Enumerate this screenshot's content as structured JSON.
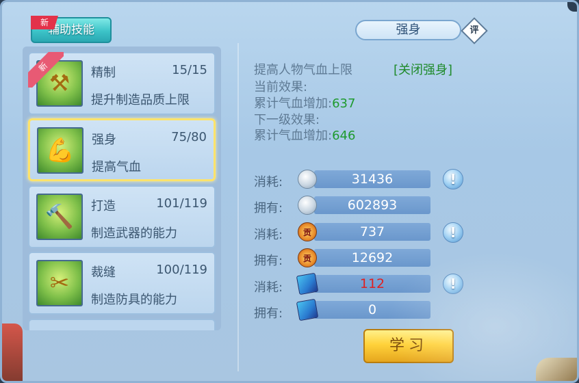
{
  "header": {
    "tab_label": "辅助技能",
    "tab_new_badge": "新",
    "title": "强身",
    "rate_label": "评"
  },
  "skills": [
    {
      "name": "精制",
      "level": "15/15",
      "desc": "提升制造品质上限",
      "new_badge": "新",
      "icon": "crafting-tools-icon"
    },
    {
      "name": "强身",
      "level": "75/80",
      "desc": "提高气血",
      "selected": true,
      "icon": "strong-man-icon"
    },
    {
      "name": "打造",
      "level": "101/119",
      "desc": "制造武器的能力",
      "icon": "hammer-anvil-icon"
    },
    {
      "name": "裁缝",
      "level": "100/119",
      "desc": "制造防具的能力",
      "icon": "scissors-cloth-icon"
    }
  ],
  "detail": {
    "summary": "提高人物气血上限",
    "toggle_link": "[关闭强身]",
    "current_label": "当前效果:",
    "current_value_label": "累计气血增加:",
    "current_value": "637",
    "next_label": "下一级效果:",
    "next_value_label": "累计气血增加:",
    "next_value": "646"
  },
  "costs": [
    {
      "label": "消耗:",
      "value": "31436",
      "icon": "silver-coin-icon",
      "help": "!"
    },
    {
      "label": "拥有:",
      "value": "602893",
      "icon": "silver-coin-icon"
    },
    {
      "label": "消耗:",
      "value": "737",
      "icon": "contribution-badge-icon",
      "help": "!"
    },
    {
      "label": "拥有:",
      "value": "12692",
      "icon": "contribution-badge-icon"
    },
    {
      "label": "消耗:",
      "value": "112",
      "icon": "skill-book-icon",
      "help": "!",
      "insufficient": true
    },
    {
      "label": "拥有:",
      "value": "0",
      "icon": "skill-book-icon"
    }
  ],
  "learn_button": "学习",
  "colors": {
    "accent_green": "#1e9a2e",
    "insufficient_red": "#e02020",
    "selected_border": "#ffe36a"
  }
}
